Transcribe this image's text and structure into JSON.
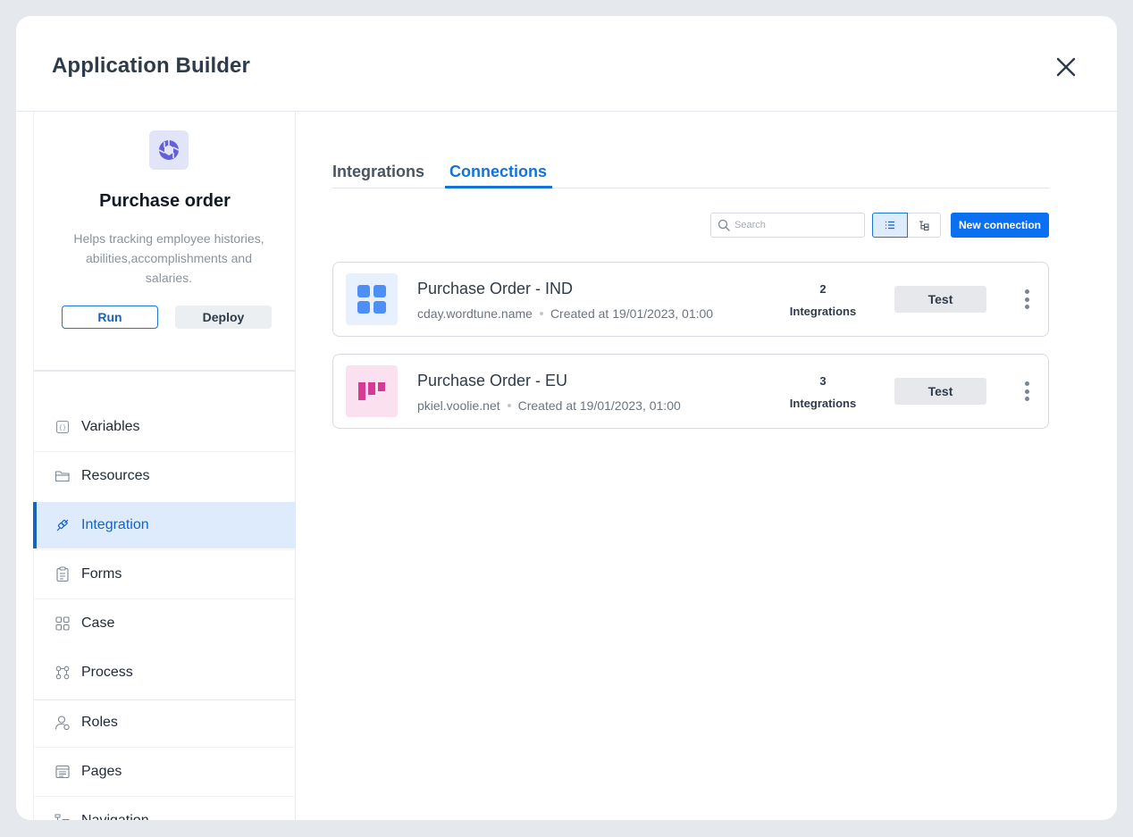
{
  "window": {
    "title": "Application Builder"
  },
  "app": {
    "name": "Purchase order",
    "description": "Helps tracking employee histories, abilities,accomplishments and salaries.",
    "run_label": "Run",
    "deploy_label": "Deploy",
    "logo_icon": "aperture-icon"
  },
  "sidebar": {
    "items": [
      {
        "label": "Variables",
        "icon": "variables-icon"
      },
      {
        "label": "Resources",
        "icon": "folder-icon"
      },
      {
        "label": "Integration",
        "icon": "plug-icon",
        "active": true
      },
      {
        "label": "Forms",
        "icon": "clipboard-icon"
      },
      {
        "label": "Case",
        "icon": "grid-icon"
      },
      {
        "label": "Process",
        "icon": "process-icon"
      },
      {
        "label": "Roles",
        "icon": "user-roles-icon"
      },
      {
        "label": "Pages",
        "icon": "pages-icon"
      },
      {
        "label": "Navigation",
        "icon": "tree-icon"
      }
    ]
  },
  "tabs": [
    {
      "label": "Integrations",
      "active": false
    },
    {
      "label": "Connections",
      "active": true
    }
  ],
  "toolbar": {
    "search_placeholder": "Search",
    "search_value": "",
    "new_connection_label": "New connection"
  },
  "connections": [
    {
      "name": "Purchase Order - IND",
      "domain": "cday.wordtune.name",
      "created": "Created at 19/01/2023, 01:00",
      "count": "2",
      "count_label": "Integrations",
      "test_label": "Test",
      "logo_color": "#4e8ef7",
      "logo_bg": "#e8f0fe"
    },
    {
      "name": "Purchase Order - EU",
      "domain": "pkiel.voolie.net",
      "created": "Created at 19/01/2023, 01:00",
      "count": "3",
      "count_label": "Integrations",
      "test_label": "Test",
      "logo_color": "#d63a92",
      "logo_bg": "#fbe0f0"
    }
  ],
  "colors": {
    "accent": "#1572d6",
    "primary_button": "#0b6ff2",
    "active_nav_bg": "#deebfd"
  }
}
